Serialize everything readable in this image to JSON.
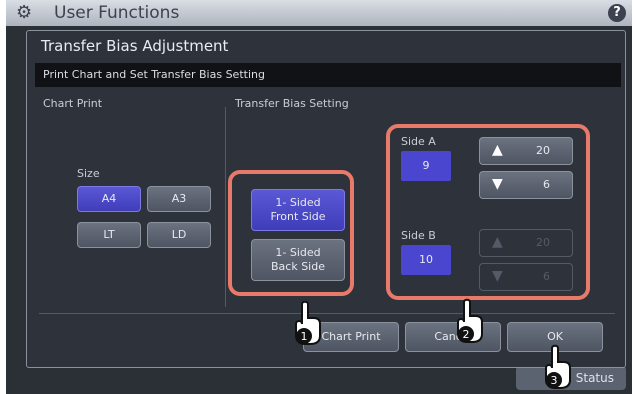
{
  "app": {
    "title": "User Functions",
    "help_icon": "?"
  },
  "background": {
    "status_label": "Status"
  },
  "dialog": {
    "title": "Transfer Bias Adjustment",
    "subheader": "Print Chart and Set Transfer Bias Setting",
    "chart_print_section": {
      "label": "Chart Print",
      "size_label": "Size",
      "sizes": [
        {
          "label": "A4",
          "selected": true
        },
        {
          "label": "A3",
          "selected": false
        },
        {
          "label": "LT",
          "selected": false
        },
        {
          "label": "LD",
          "selected": false
        }
      ]
    },
    "transfer_bias_section": {
      "label": "Transfer Bias Setting",
      "sides": [
        {
          "line1": "1- Sided",
          "line2": "Front Side",
          "selected": true
        },
        {
          "line1": "1- Sided",
          "line2": "Back Side",
          "selected": false
        }
      ],
      "side_a": {
        "label": "Side A",
        "value": "9",
        "up_value": "20",
        "down_value": "6"
      },
      "side_b": {
        "label": "Side B",
        "value": "10",
        "up_value": "20",
        "down_value": "6"
      }
    },
    "buttons": {
      "chart_print": "Chart Print",
      "cancel": "Cancel",
      "ok": "OK"
    }
  },
  "callouts": [
    "1",
    "2",
    "3"
  ],
  "colors": {
    "accent_blue": "#4b46cf",
    "highlight": "#e87a6a"
  }
}
